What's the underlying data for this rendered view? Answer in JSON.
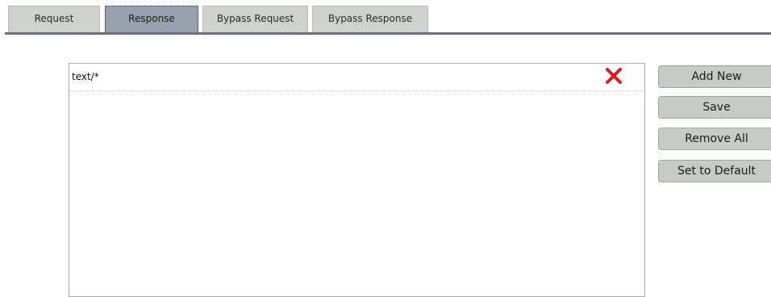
{
  "tabs": [
    {
      "label": "Request"
    },
    {
      "label": "Response",
      "active": true
    },
    {
      "label": "Bypass Request"
    },
    {
      "label": "Bypass Response"
    }
  ],
  "list": {
    "items": [
      {
        "value": "text/*"
      }
    ]
  },
  "buttons": {
    "add_new": "Add New",
    "save": "Save",
    "remove_all": "Remove All",
    "set_to_default": "Set to Default"
  },
  "colors": {
    "active_tab": "#98a1ad",
    "inactive_tab": "#cfd1cd",
    "tab_underline": "#69727f",
    "remove_icon": "#e01a1a",
    "button_bg": "#c7cbc6"
  },
  "icons": {
    "remove": "close-x-icon"
  }
}
